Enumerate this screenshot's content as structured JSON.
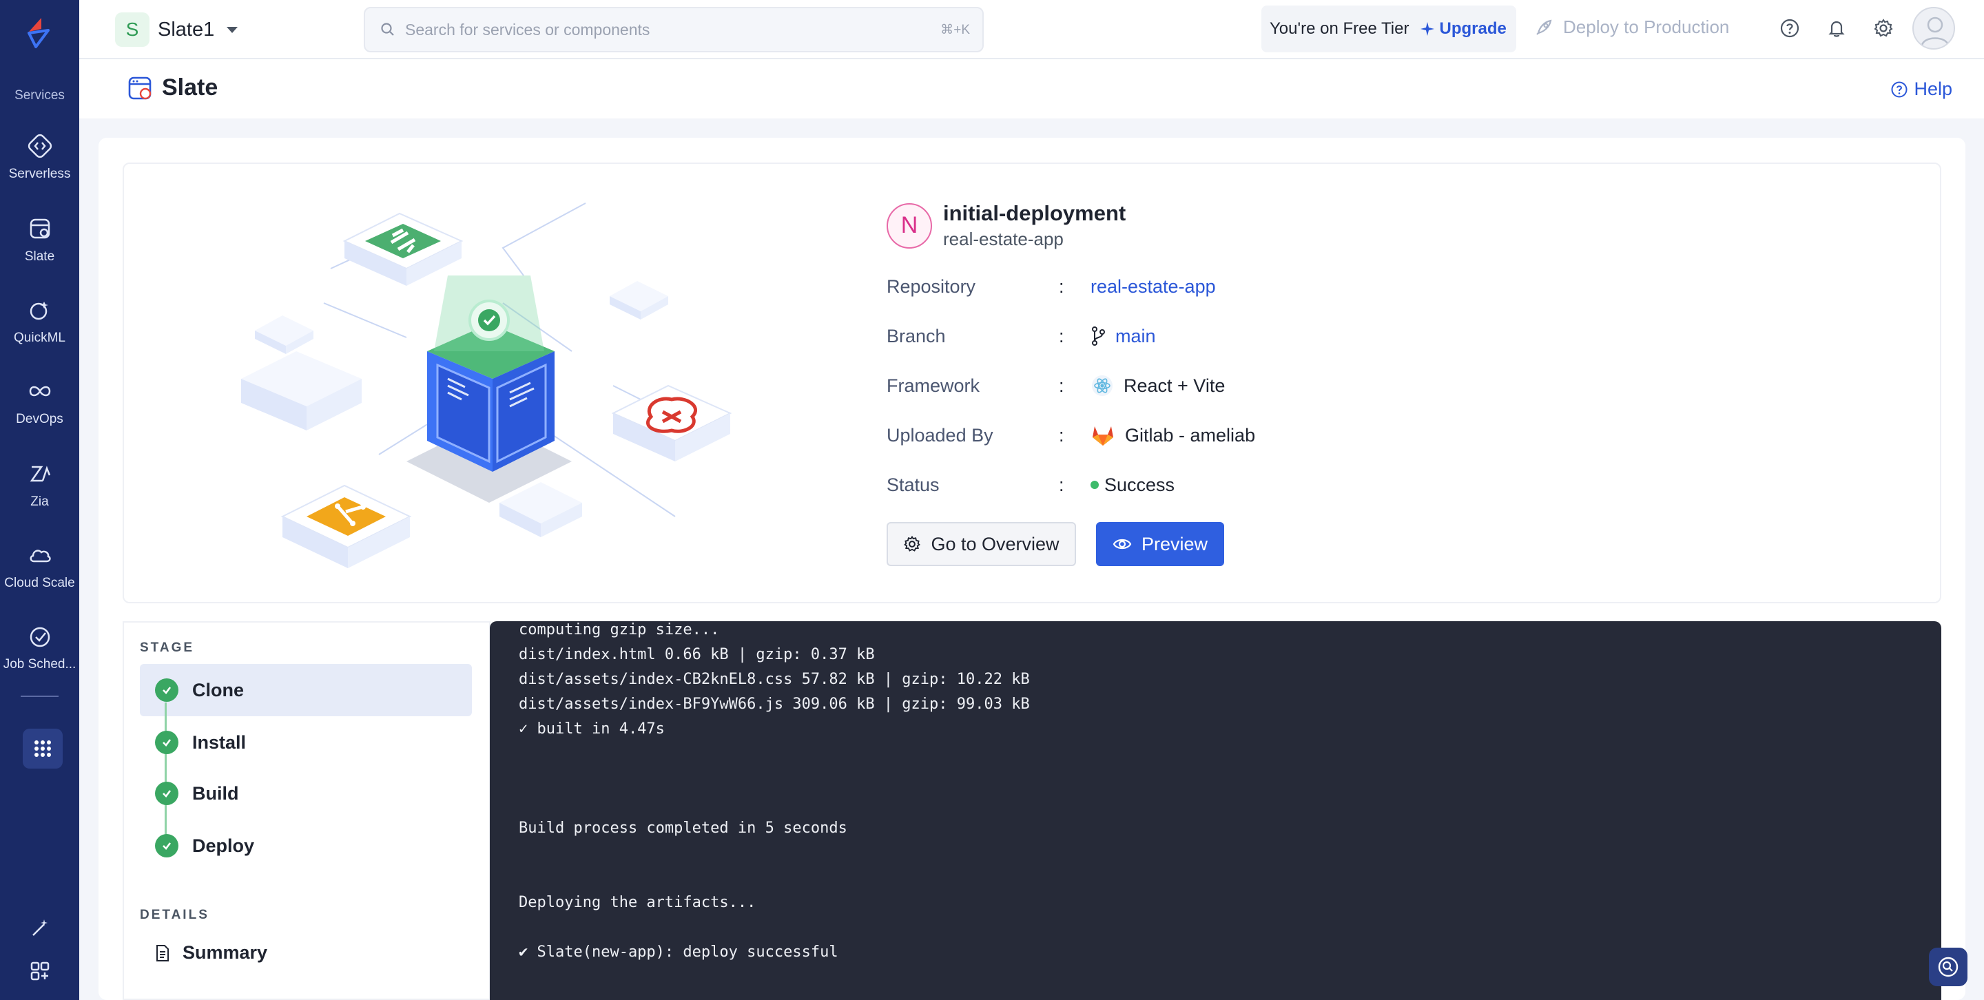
{
  "sidebar": {
    "section_label": "Services",
    "items": [
      {
        "label": "Serverless",
        "icon": "serverless-icon"
      },
      {
        "label": "Slate",
        "icon": "slate-icon"
      },
      {
        "label": "QuickML",
        "icon": "quickml-icon"
      },
      {
        "label": "DevOps",
        "icon": "devops-icon"
      },
      {
        "label": "Zia",
        "icon": "zia-icon"
      },
      {
        "label": "Cloud Scale",
        "icon": "cloud-scale-icon"
      },
      {
        "label": "Job Sched...",
        "icon": "job-scheduling-icon"
      }
    ]
  },
  "topbar": {
    "project_initial": "S",
    "project_name": "Slate1",
    "search_placeholder": "Search for services or components",
    "search_shortcut": "⌘+K",
    "tier_text": "You're on Free Tier",
    "upgrade_label": "Upgrade",
    "deploy_label": "Deploy to Production"
  },
  "page": {
    "title": "Slate",
    "help_label": "Help"
  },
  "deployment": {
    "initial": "N",
    "name": "initial-deployment",
    "app": "real-estate-app",
    "details": [
      {
        "label": "Repository",
        "value": "real-estate-app"
      },
      {
        "label": "Branch",
        "value": "main"
      },
      {
        "label": "Framework",
        "value": "React + Vite"
      },
      {
        "label": "Uploaded By",
        "value": "Gitlab - ameliab"
      },
      {
        "label": "Status",
        "value": "Success"
      }
    ],
    "overview_button": "Go to Overview",
    "preview_button": "Preview"
  },
  "stages": {
    "title": "STAGE",
    "items": [
      "Clone",
      "Install",
      "Build",
      "Deploy"
    ],
    "details_title": "DETAILS",
    "summary_label": "Summary"
  },
  "log": [
    "computing gzip size...",
    "dist/index.html 0.66 kB | gzip: 0.37 kB",
    "dist/assets/index-CB2knEL8.css 57.82 kB | gzip: 10.22 kB",
    "dist/assets/index-BF9YwW66.js 309.06 kB | gzip: 99.03 kB",
    "✓ built in 4.47s",
    "Build process completed in 5 seconds",
    "Deploying the artifacts...",
    "✔ Slate(new-app): deploy successful"
  ],
  "colors": {
    "sidebar": "#1a2a66",
    "accent": "#2f5fe0",
    "success": "#3aa762",
    "log_bg": "#262a38"
  }
}
